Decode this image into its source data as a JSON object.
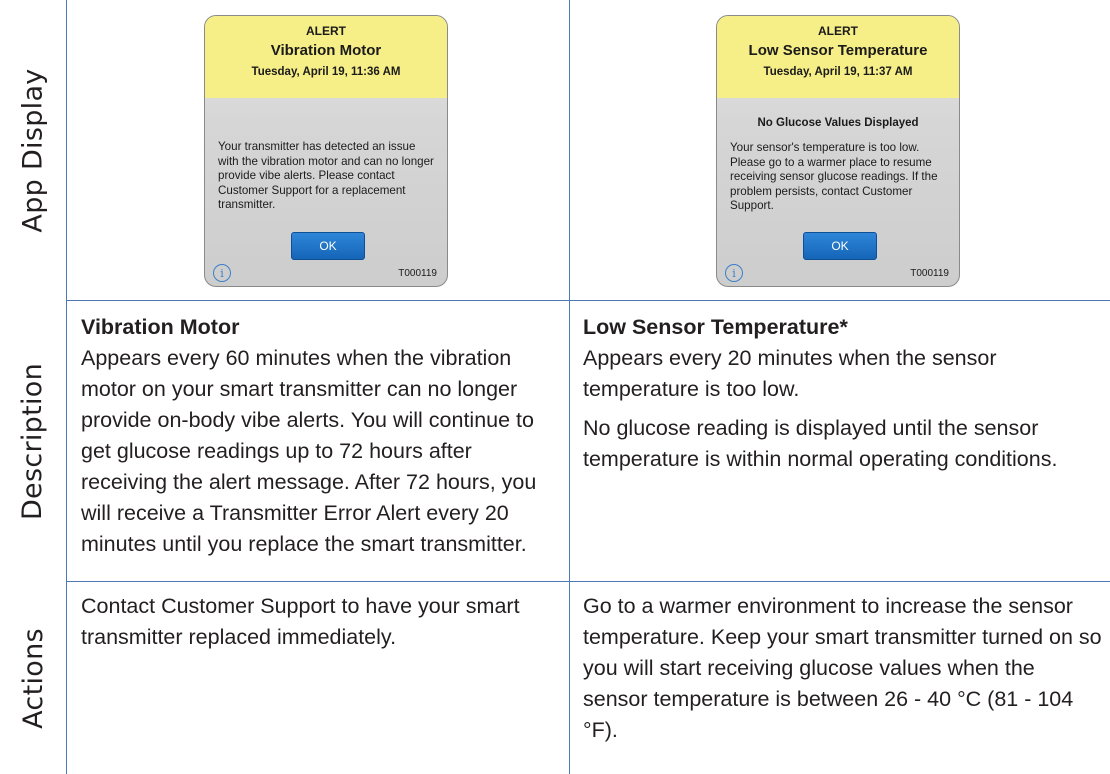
{
  "row_labels": {
    "app_display": "App Display",
    "description": "Description",
    "actions": "Actions"
  },
  "columns": [
    {
      "phone": {
        "alert_label": "ALERT",
        "alert_title": "Vibration Motor",
        "timestamp": "Tuesday, April 19, 11:36 AM",
        "subtitle": "",
        "message": "Your transmitter has detected an issue with the vibration motor and can no longer provide vibe alerts. Please contact Customer Support for a replacement transmitter.",
        "ok_label": "OK",
        "info_glyph": "i",
        "code": "T000119"
      },
      "description": {
        "title": "Vibration Motor",
        "paragraphs": [
          "Appears every 60 minutes when the vibration motor on your smart transmitter can no longer provide on-body vibe alerts. You will continue to get glucose readings up to 72 hours after receiving the alert message. After 72 hours, you will receive a Transmitter Error Alert every 20 minutes until you replace the smart transmitter."
        ]
      },
      "actions": "Contact Customer Support to have your smart transmitter replaced immediately."
    },
    {
      "phone": {
        "alert_label": "ALERT",
        "alert_title": "Low Sensor Temperature",
        "timestamp": "Tuesday, April 19, 11:37 AM",
        "subtitle": "No Glucose Values Displayed",
        "message": "Your sensor's temperature is too low. Please go to a warmer place to resume receiving sensor glucose readings. If the problem persists, contact Customer Support.",
        "ok_label": "OK",
        "info_glyph": "i",
        "code": "T000119"
      },
      "description": {
        "title": "Low Sensor Temperature*",
        "paragraphs": [
          "Appears every 20 minutes when the sensor temperature is too low.",
          "No glucose reading is displayed until the sensor temperature is within normal operating conditions."
        ]
      },
      "actions": "Go to a warmer environment to increase the sensor temperature. Keep your smart transmitter turned on so you will start receiving glucose values when the sensor temperature is between 26 - 40 °C (81 - 104 °F)."
    }
  ]
}
